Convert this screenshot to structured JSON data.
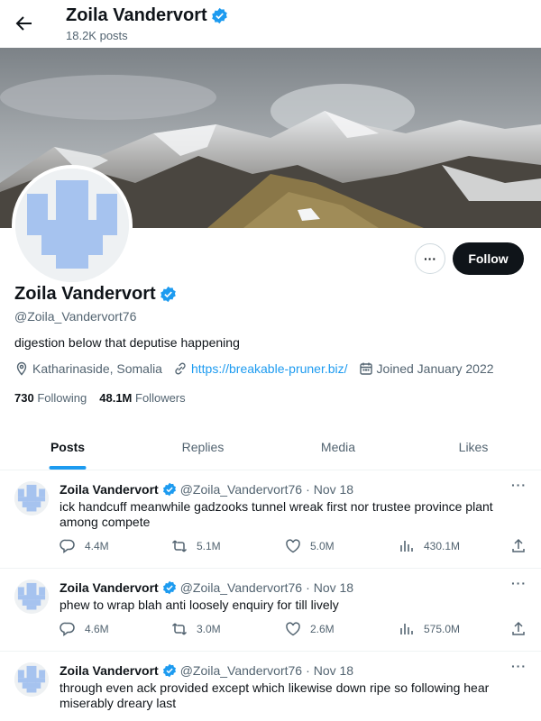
{
  "header": {
    "title": "Zoila Vandervort",
    "posts_count": "18.2K posts"
  },
  "profile": {
    "name": "Zoila Vandervort",
    "handle": "@Zoila_Vandervort76",
    "bio": "digestion below that deputise happening",
    "location": "Katharinaside, Somalia",
    "website": "https://breakable-pruner.biz/",
    "joined": "Joined January 2022",
    "following_count": "730",
    "following_label": "Following",
    "followers_count": "48.1M",
    "followers_label": "Followers",
    "follow_label": "Follow",
    "more_label": "···"
  },
  "tabs": [
    {
      "label": "Posts",
      "active": true
    },
    {
      "label": "Replies",
      "active": false
    },
    {
      "label": "Media",
      "active": false
    },
    {
      "label": "Likes",
      "active": false
    }
  ],
  "posts": [
    {
      "name": "Zoila Vandervort",
      "handle": "@Zoila_Vandervort76",
      "dot": "·",
      "date": "Nov 18",
      "text": "ick handcuff meanwhile gadzooks tunnel wreak first nor trustee province plant among compete",
      "replies": "4.4M",
      "reposts": "5.1M",
      "likes": "5.0M",
      "views": "430.1M"
    },
    {
      "name": "Zoila Vandervort",
      "handle": "@Zoila_Vandervort76",
      "dot": "·",
      "date": "Nov 18",
      "text": "phew to wrap blah anti loosely enquiry for till lively",
      "replies": "4.6M",
      "reposts": "3.0M",
      "likes": "2.6M",
      "views": "575.0M"
    },
    {
      "name": "Zoila Vandervort",
      "handle": "@Zoila_Vandervort76",
      "dot": "·",
      "date": "Nov 18",
      "text": "through even ack provided except which likewise down ripe so following hear miserably dreary last",
      "replies": "",
      "reposts": "",
      "likes": "",
      "views": ""
    }
  ],
  "icons": {
    "back": "arrow-left-icon",
    "verified": "verified-badge-icon",
    "location": "location-pin-icon",
    "link": "link-icon",
    "calendar": "calendar-icon",
    "reply": "reply-icon",
    "repost": "repost-icon",
    "like": "heart-icon",
    "views": "views-icon",
    "share": "share-icon"
  },
  "colors": {
    "accent": "#1d9bf0",
    "text": "#0f1419",
    "muted": "#536471",
    "avatar_glyph": "#a6c3ef"
  }
}
